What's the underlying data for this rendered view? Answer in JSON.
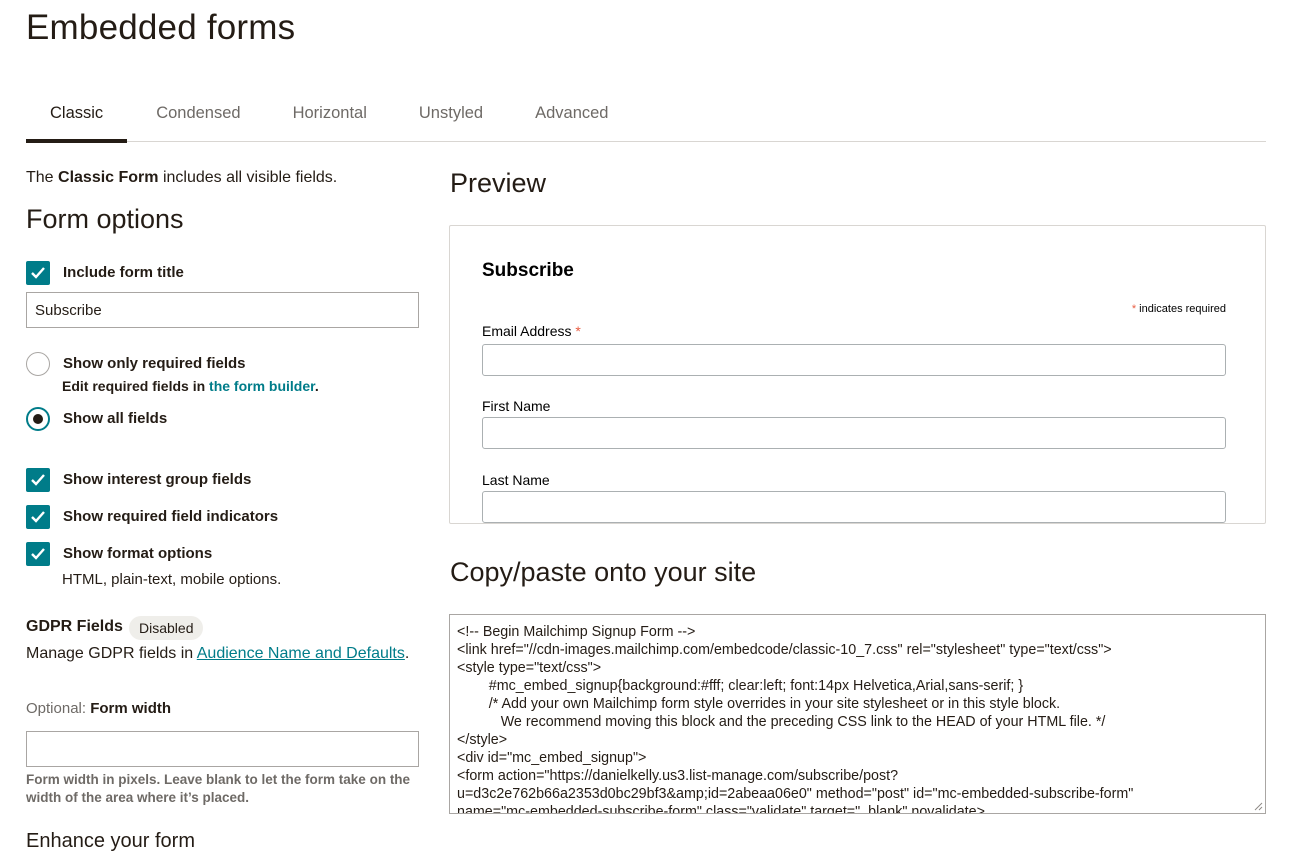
{
  "page": {
    "title": "Embedded forms"
  },
  "tabs": [
    {
      "label": "Classic",
      "active": true
    },
    {
      "label": "Condensed",
      "active": false
    },
    {
      "label": "Horizontal",
      "active": false
    },
    {
      "label": "Unstyled",
      "active": false
    },
    {
      "label": "Advanced",
      "active": false
    }
  ],
  "intro": {
    "prefix": "The ",
    "bold": "Classic Form",
    "suffix": " includes all visible fields."
  },
  "form_options": {
    "title": "Form options",
    "include_title": {
      "label": "Include form title",
      "checked": true
    },
    "title_input": {
      "value": "Subscribe"
    },
    "show_required": {
      "label": "Show only required fields",
      "selected": false
    },
    "required_note": {
      "prefix": "Edit required fields in ",
      "link": "the form builder",
      "suffix": "."
    },
    "show_all": {
      "label": "Show all fields",
      "selected": true
    },
    "interest_groups": {
      "label": "Show interest group fields",
      "checked": true
    },
    "required_indicators": {
      "label": "Show required field indicators",
      "checked": true
    },
    "format_options": {
      "label": "Show format options",
      "checked": true,
      "note": "HTML, plain-text, mobile options."
    }
  },
  "gdpr": {
    "title": "GDPR Fields",
    "badge": "Disabled",
    "text_prefix": "Manage GDPR fields in ",
    "link": "Audience Name and Defaults",
    "text_suffix": "."
  },
  "form_width": {
    "optional": "Optional: ",
    "label": "Form width",
    "value": "",
    "help": "Form width in pixels. Leave blank to let the form take on the width of the area where it’s placed."
  },
  "enhance": {
    "title": "Enhance your form"
  },
  "preview": {
    "title": "Preview",
    "form_title": "Subscribe",
    "required_star": "*",
    "required_note": " indicates required",
    "fields": [
      {
        "label": "Email Address",
        "required": true
      },
      {
        "label": "First Name",
        "required": false
      },
      {
        "label": "Last Name",
        "required": false
      }
    ]
  },
  "copy_paste": {
    "title": "Copy/paste onto your site",
    "code_lines": [
      "<!-- Begin Mailchimp Signup Form -->",
      "<link href=\"//cdn-images.mailchimp.com/embedcode/classic-10_7.css\" rel=\"stylesheet\" type=\"text/css\">",
      "<style type=\"text/css\">",
      "        #mc_embed_signup{background:#fff; clear:left; font:14px Helvetica,Arial,sans-serif; }",
      "        /* Add your own Mailchimp form style overrides in your site stylesheet or in this style block.",
      "           We recommend moving this block and the preceding CSS link to the HEAD of your HTML file. */",
      "</style>",
      "<div id=\"mc_embed_signup\">",
      "<form action=\"https://danielkelly.us3.list-manage.com/subscribe/post?",
      "u=d3c2e762b66a2353d0bc29bf3&amp;id=2abeaa06e0\" method=\"post\" id=\"mc-embedded-subscribe-form\"",
      "name=\"mc-embedded-subscribe-form\" class=\"validate\" target=\"_blank\" novalidate>"
    ]
  },
  "colors": {
    "accent": "#007c89",
    "text": "#241c15",
    "muted": "#6e6a66",
    "required": "#e85c41"
  },
  "icons": {
    "checkbox": "check-icon",
    "resize": "resize-grip-icon"
  }
}
